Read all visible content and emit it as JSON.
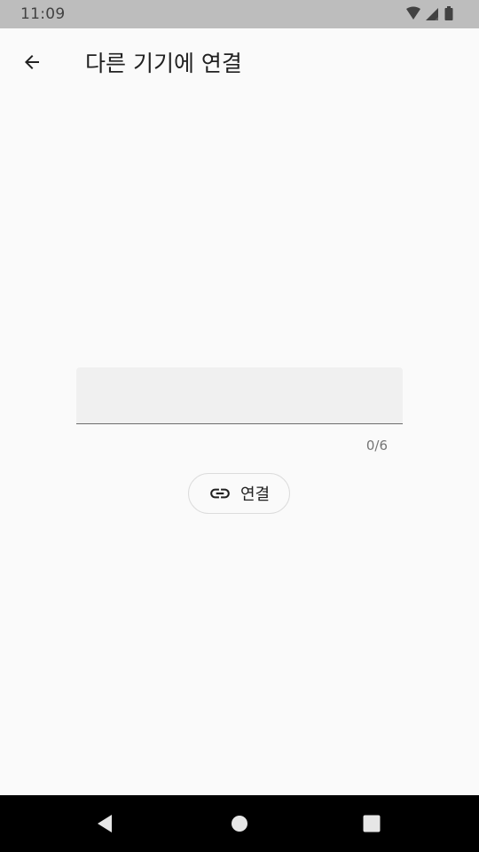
{
  "status_bar": {
    "time": "11:09",
    "icons": [
      "wifi-icon",
      "cell-signal-icon",
      "battery-icon"
    ]
  },
  "app_bar": {
    "back_icon": "arrow-back-icon",
    "title": "다른 기기에 연결"
  },
  "form": {
    "code_input_value": "",
    "counter": "0/6",
    "connect_label": "연결",
    "connect_icon": "link-icon"
  },
  "nav_bar": {
    "icons": [
      "nav-back-icon",
      "nav-home-icon",
      "nav-recents-icon"
    ]
  },
  "colors": {
    "background": "#fafafa",
    "status_bar": "#bdbdbd",
    "field_fill": "#f0f0f0",
    "field_underline": "#6e6e6e",
    "nav_bar": "#000000"
  }
}
